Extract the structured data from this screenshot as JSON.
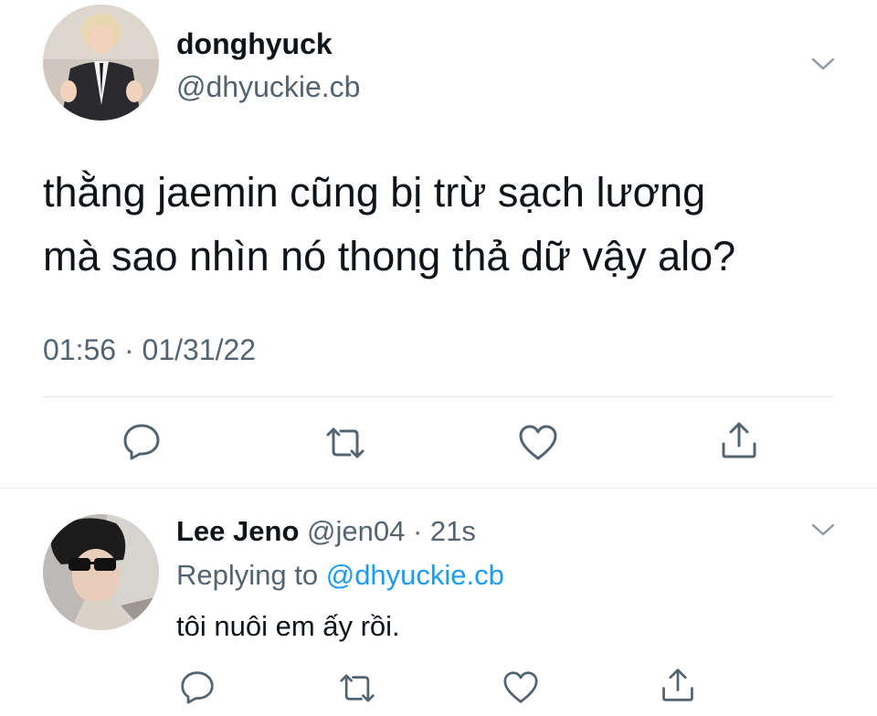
{
  "tweet": {
    "author_name": "donghyuck",
    "author_handle": "@dhyuckie.cb",
    "text_lines": [
      "thằng jaemin cũng bị trừ sạch lương",
      "mà sao nhìn nó thong thả dữ vậy alo?"
    ],
    "time": "01:56",
    "separator": "·",
    "date": "01/31/22",
    "actions": [
      "reply-icon",
      "retweet-icon",
      "like-icon",
      "share-icon"
    ]
  },
  "reply": {
    "author_name": "Lee Jeno",
    "author_handle": "@jen04",
    "separator": "·",
    "time_ago": "21s",
    "replying_prefix": "Replying to",
    "replying_to": "@dhyuckie.cb",
    "text": "tôi nuôi em ấy rồi.",
    "actions": [
      "reply-icon",
      "retweet-icon",
      "like-icon",
      "share-icon"
    ]
  },
  "colors": {
    "text": "#0f1419",
    "secondary": "#536471",
    "link": "#1d9bf0",
    "icon": "#536471",
    "divider": "#e1e6ea"
  }
}
